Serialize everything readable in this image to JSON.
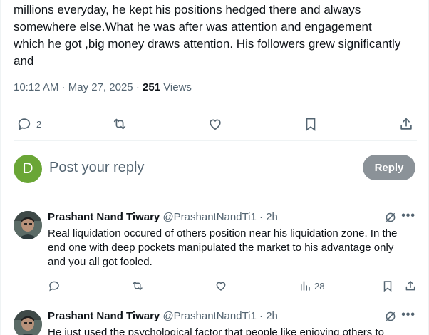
{
  "post": {
    "text_lines": [
      "millions everyday, he kept his positions hedged there and always",
      "somewhere else.What he was after was attention and engagement",
      "which he got ,big money draws attention. His followers grew significantly",
      "and"
    ],
    "time": "10:12 AM",
    "date": "May 27, 2025",
    "views_count": "251",
    "views_label": "Views",
    "separator": "·",
    "reply_count": "2"
  },
  "reply_composer": {
    "avatar_letter": "D",
    "placeholder": "Post your reply",
    "reply_button": "Reply"
  },
  "comments": [
    {
      "name": "Prashant Nand Tiwary",
      "handle": "@PrashantNandTi1",
      "time": "2h",
      "text_lines": [
        "Real liquidation occured of others position near his liquidation zone. In the",
        "end one with deep pockets manipulated the market to his advantage only",
        "and you all got fooled."
      ],
      "views": "28"
    },
    {
      "name": "Prashant Nand Tiwary",
      "handle": "@PrashantNandTi1",
      "time": "2h",
      "text_lines": [
        "He just used the psychological factor that people like enjoying others to"
      ]
    }
  ],
  "icons": {
    "reply": "reply-icon",
    "repost": "repost-icon",
    "like": "heart-icon",
    "bookmark": "bookmark-icon",
    "share": "share-icon",
    "views": "views-icon",
    "grok": "grok-icon",
    "more": "more-icon"
  },
  "colors": {
    "text": "#0f1419",
    "muted": "#536471",
    "avatar_d": "#6aa636",
    "reply_button": "#8b9298",
    "divider": "#eff3f4"
  }
}
